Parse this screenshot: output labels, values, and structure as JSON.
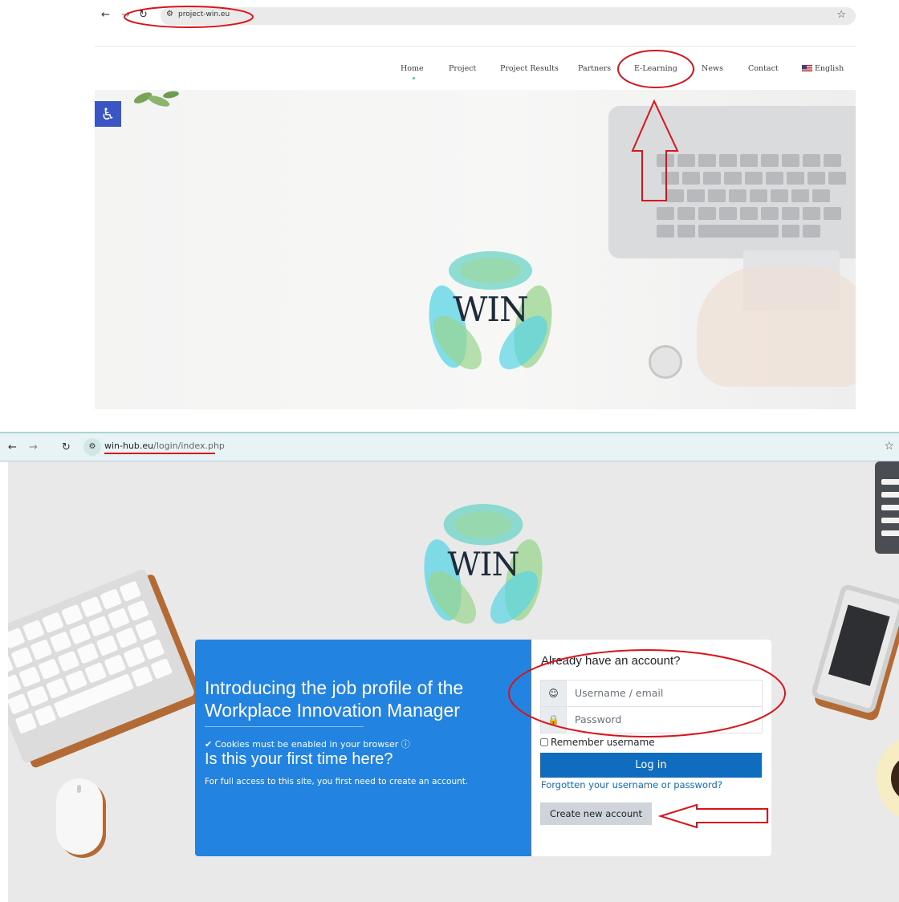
{
  "top_browser": {
    "back_icon": "arrow-left",
    "forward_icon": "arrow-right",
    "reload_icon": "reload",
    "url": "project-win.eu",
    "star_icon": "star"
  },
  "site_nav": {
    "items": [
      "Home",
      "Project",
      "Project Results",
      "Partners",
      "E-Learning",
      "News",
      "Contact",
      "English"
    ]
  },
  "hero": {
    "logo_text": "WIN",
    "accessibility_icon": "wheelchair"
  },
  "bottom_browser": {
    "url_domain": "win-hub.eu",
    "url_path": "/login/index.php"
  },
  "login_page": {
    "logo_text": "WIN",
    "intro_heading": "Introducing the job profile of the Workplace Innovation Manager",
    "cookies_notice": "Cookies must be enabled in your browser",
    "first_time_heading": "Is this your first time here?",
    "first_time_text": "For full access to this site, you first need to create an account.",
    "already_heading": "Already have an account?",
    "username_placeholder": "Username / email",
    "password_placeholder": "Password",
    "remember_label": "Remember username",
    "login_button": "Log in",
    "forgot_link": "Forgotten your username or password?",
    "create_button": "Create new account"
  },
  "colors": {
    "annotation_red": "#d9141b",
    "login_primary": "#0f6cbf",
    "left_panel": "#2383e0",
    "accessibility": "#3b55c4"
  }
}
